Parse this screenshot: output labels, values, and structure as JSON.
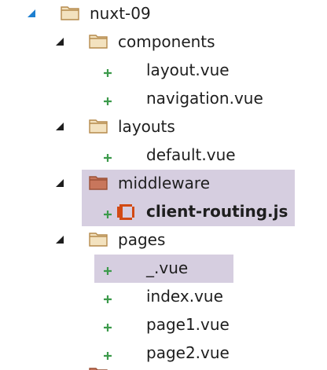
{
  "explorer": {
    "items": [
      {
        "label": "nuxt-09",
        "kind": "folder",
        "expanded": true,
        "selected_arrow": true
      },
      {
        "label": "components",
        "kind": "folder",
        "expanded": true
      },
      {
        "label": "layout.vue",
        "kind": "file",
        "status": "added"
      },
      {
        "label": "navigation.vue",
        "kind": "file",
        "status": "added"
      },
      {
        "label": "layouts",
        "kind": "folder",
        "expanded": true
      },
      {
        "label": "default.vue",
        "kind": "file",
        "status": "added"
      },
      {
        "label": "middleware",
        "kind": "folder",
        "expanded": true,
        "highlighted": true,
        "icon_color": "#c8765c"
      },
      {
        "label": "client-routing.js",
        "kind": "file",
        "status": "added",
        "highlighted": true,
        "bold": true,
        "icon": "js-file-icon",
        "icon_color": "#d24a14"
      },
      {
        "label": "pages",
        "kind": "folder",
        "expanded": true
      },
      {
        "label": "_.vue",
        "kind": "file",
        "status": "added",
        "highlighted": true
      },
      {
        "label": "index.vue",
        "kind": "file",
        "status": "added"
      },
      {
        "label": "page1.vue",
        "kind": "file",
        "status": "added"
      },
      {
        "label": "page2.vue",
        "kind": "file",
        "status": "added"
      }
    ]
  },
  "colors": {
    "highlight": "#d6cee0",
    "folder": "#dcb67a",
    "folder_open": "#c8765c",
    "added_plus": "#3c9a4b",
    "arrow": "#1e1e1e",
    "arrow_selected": "#1e7fd0"
  }
}
